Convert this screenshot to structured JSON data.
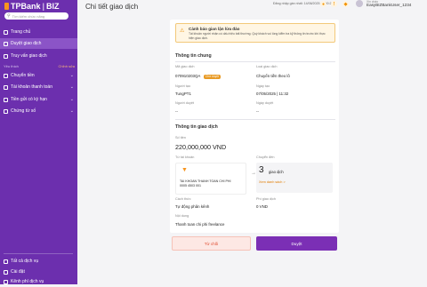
{
  "sidebar": {
    "brand_tp": "TPBank",
    "brand_biz": "BIZ",
    "search_placeholder": "Tìm kiếm chức năng",
    "items": [
      {
        "label": "Trang chủ"
      },
      {
        "label": "Duyệt giao dịch"
      },
      {
        "label": "Truy vấn giao dịch"
      }
    ],
    "section_label": "Yêu thích",
    "section_edit": "Chỉnh sửa",
    "fav_items": [
      {
        "label": "Chuyển tiền"
      },
      {
        "label": "Tài khoản thanh toán"
      },
      {
        "label": "Tiền gửi có kỳ hạn"
      },
      {
        "label": "Chứng từ số"
      }
    ],
    "bottom_items": [
      {
        "label": "Tất cả dịch vụ"
      },
      {
        "label": "Cài đặt"
      },
      {
        "label": "Kênh phí dịch vụ"
      }
    ]
  },
  "topbar": {
    "login_time": "Đăng nhập gần nhất: 14/06/2025 19:00:24",
    "welcome": "Xin chào",
    "user_name": "EasyBIZBankUser_1234"
  },
  "page": {
    "title": "Chi tiết giao dịch"
  },
  "alert": {
    "title": "Cảnh báo gian lận lừa đảo",
    "body": "Tài khoản người nhận có dấu hiệu bất thường. Quý khách vui lòng kiểm tra kỹ thông tin trước khi thực hiện giao dịch."
  },
  "general": {
    "section_title": "Thông tin chung",
    "txn_code_label": "Mã giao dịch",
    "txn_code": "070910203QA",
    "status_badge": "Chờ duyệt",
    "txn_type_label": "Loại giao dịch",
    "txn_type": "Chuyển tiền theo lô",
    "creator_label": "Người tạo",
    "creator": "TungPT1",
    "created_date_label": "Ngày tạo",
    "created_date": "07/05/2025 | 11:32",
    "approver_label": "Người duyệt",
    "approver": "--",
    "approved_date_label": "Ngày duyệt",
    "approved_date": "--"
  },
  "transaction": {
    "section_title": "Thông tin giao dịch",
    "amount_label": "Số tiền",
    "amount": "220,000,000 VND",
    "from_label": "Từ tài khoản",
    "to_label": "Chuyển đến",
    "from_account_name": "TAI KHOAN THANH TOAN CHI PHI",
    "from_account_number": "0005 4503 001",
    "to_count": "3",
    "to_count_label": "giao dịch",
    "see_list": "Xem danh sách >",
    "method_label": "Cách thức",
    "method": "Tự động phân kênh",
    "fee_label": "Phí giao dịch",
    "fee": "0 VND",
    "content_label": "Nội dung",
    "content": "Thanh toan chi phi freelance"
  },
  "actions": {
    "reject": "Từ chối",
    "approve": "Duyệt"
  },
  "colors": {
    "sidebar": "#6c2fae",
    "accent": "#f7941d",
    "approve": "#7b2fb5",
    "reject_text": "#e04a2e"
  }
}
